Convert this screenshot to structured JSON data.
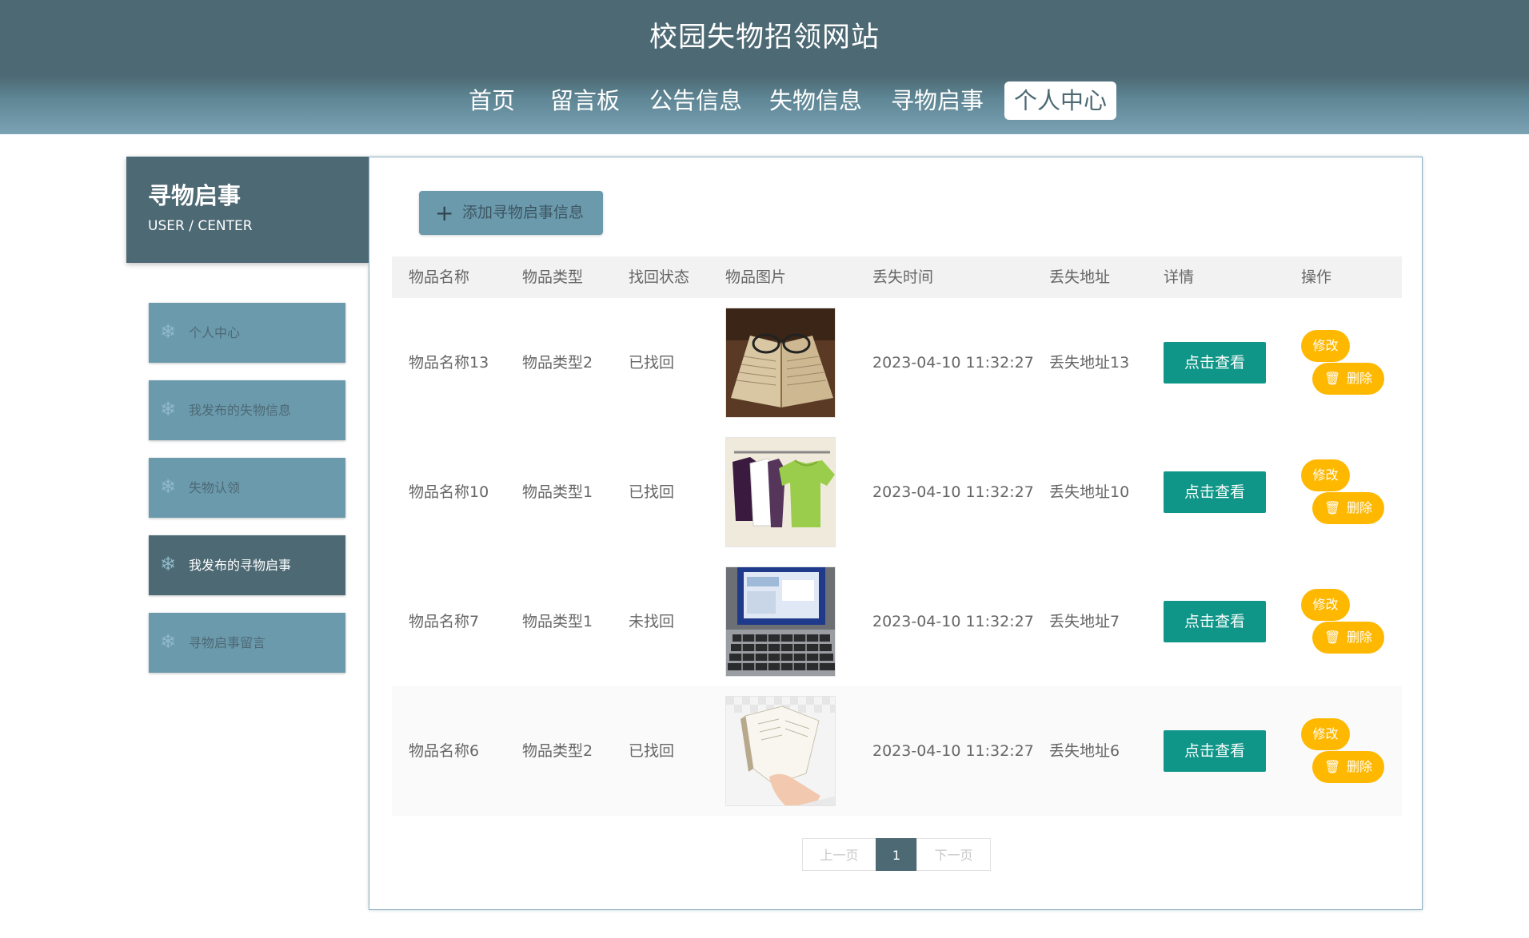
{
  "site": {
    "title": "校园失物招领网站"
  },
  "nav": [
    {
      "label": "首页",
      "active": false
    },
    {
      "label": "留言板",
      "active": false
    },
    {
      "label": "公告信息",
      "active": false
    },
    {
      "label": "失物信息",
      "active": false
    },
    {
      "label": "寻物启事",
      "active": false
    },
    {
      "label": "个人中心",
      "active": true
    }
  ],
  "sidebar": {
    "title": "寻物启事",
    "subtitle": "USER / CENTER",
    "items": [
      {
        "label": "个人中心",
        "active": false,
        "icon": "snowflake-icon"
      },
      {
        "label": "我发布的失物信息",
        "active": false,
        "icon": "snowflake-icon"
      },
      {
        "label": "失物认领",
        "active": false,
        "icon": "snowflake-icon"
      },
      {
        "label": "我发布的寻物启事",
        "active": true,
        "icon": "snowflake-icon"
      },
      {
        "label": "寻物启事留言",
        "active": false,
        "icon": "snowflake-icon"
      }
    ]
  },
  "main": {
    "add_button": {
      "icon": "plus-icon",
      "label": "添加寻物启事信息"
    },
    "table": {
      "headers": [
        "物品名称",
        "物品类型",
        "找回状态",
        "物品图片",
        "丢失时间",
        "丢失地址",
        "详情",
        "操作"
      ],
      "rows": [
        {
          "name": "物品名称13",
          "type": "物品类型2",
          "status": "已找回",
          "image": "book-glasses-photo",
          "time": "2023-04-10 11:32:27",
          "address": "丢失地址13"
        },
        {
          "name": "物品名称10",
          "type": "物品类型1",
          "status": "已找回",
          "image": "tshirts-photo",
          "time": "2023-04-10 11:32:27",
          "address": "丢失地址10"
        },
        {
          "name": "物品名称7",
          "type": "物品类型1",
          "status": "未找回",
          "image": "laptop-photo",
          "time": "2023-04-10 11:32:27",
          "address": "丢失地址7"
        },
        {
          "name": "物品名称6",
          "type": "物品类型2",
          "status": "已找回",
          "image": "hand-book-photo",
          "time": "2023-04-10 11:32:27",
          "address": "丢失地址6"
        }
      ],
      "view_label": "点击查看",
      "edit_label": "修改",
      "delete_label": "删除",
      "delete_icon": "trash-icon"
    },
    "pagination": {
      "prev": "上一页",
      "current": "1",
      "next": "下一页"
    }
  },
  "colors": {
    "header_bg": "#4d6974",
    "menu_bg": "#6b9aad",
    "view_button": "#0f9688",
    "action_button": "#ffb800"
  }
}
